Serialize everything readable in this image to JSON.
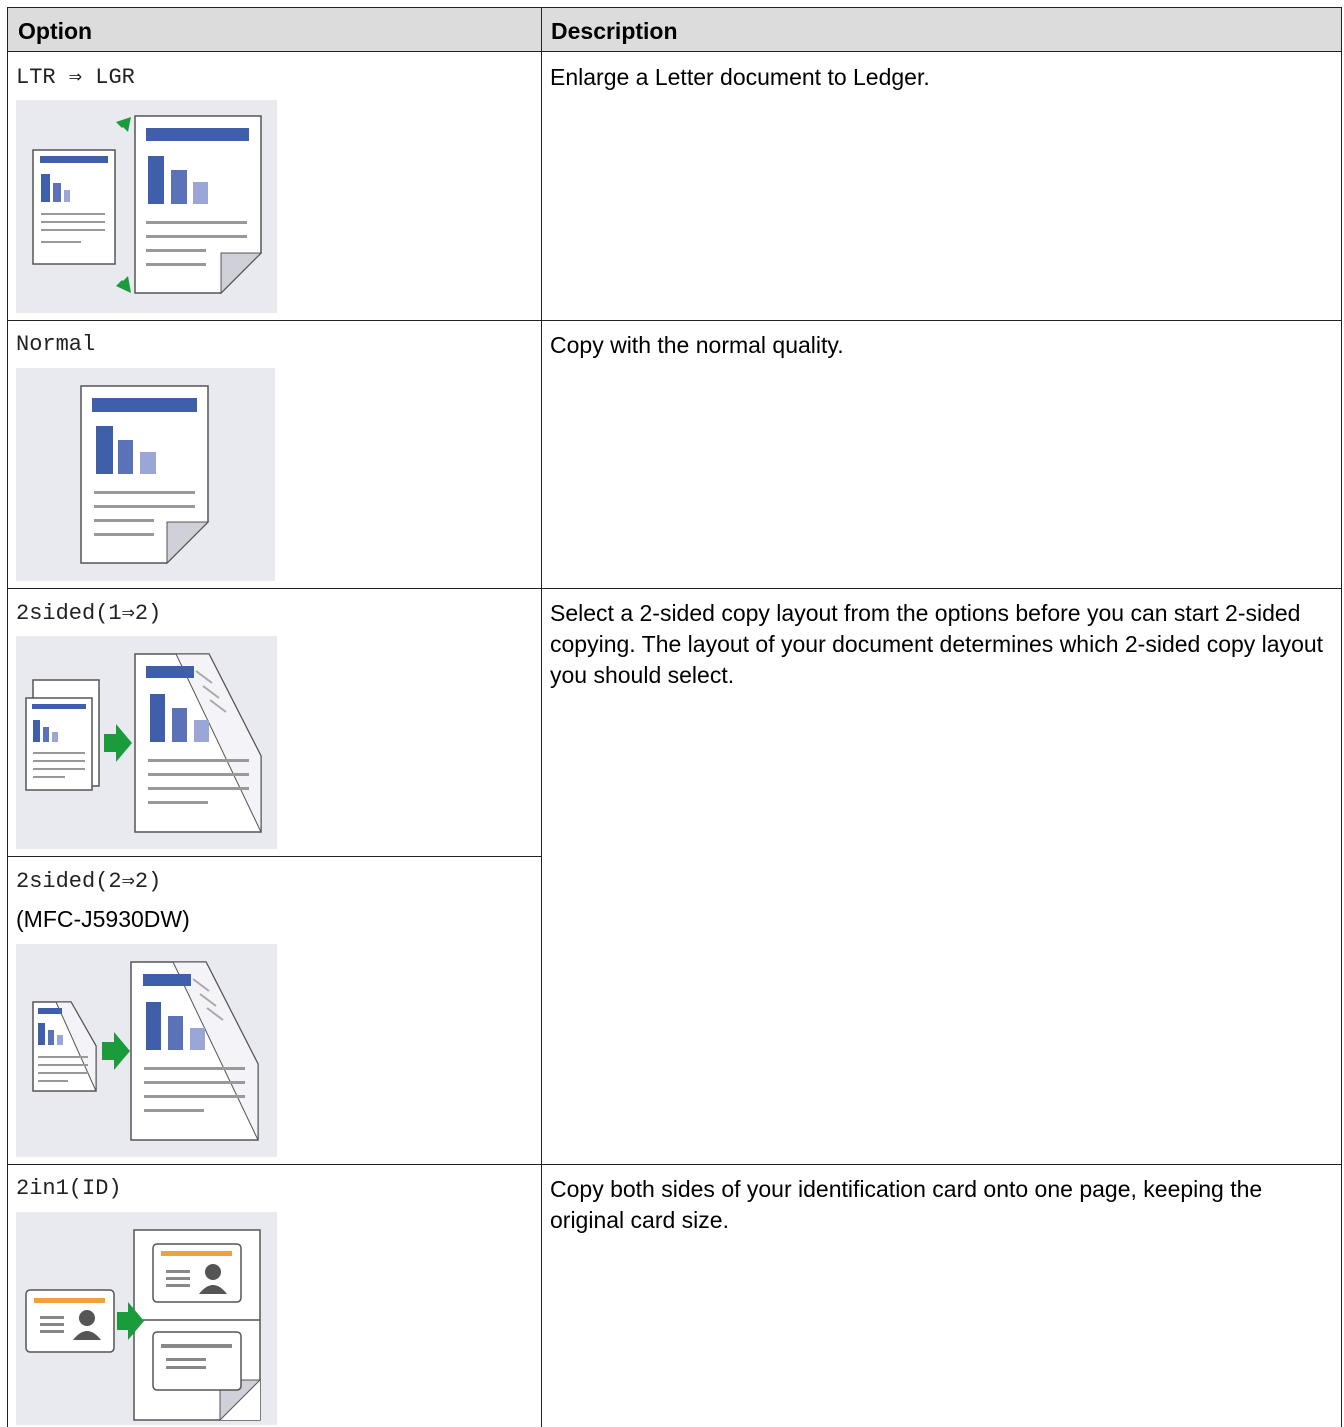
{
  "table": {
    "headers": {
      "option": "Option",
      "description": "Description"
    },
    "rows": [
      {
        "option": "LTR ⇒ LGR",
        "description": "Enlarge a Letter document to Ledger.",
        "illustration": "enlarge-ltr-to-lgr-illustration"
      },
      {
        "option": "Normal",
        "description": "Copy with the normal quality.",
        "illustration": "normal-copy-illustration"
      },
      {
        "option": "2sided(1⇒2)",
        "description": "Select a 2-sided copy layout from the options before you can start 2-sided copying. The layout of your document determines which 2-sided copy layout you should select.",
        "illustration": "two-sided-1-to-2-illustration"
      },
      {
        "option": "2sided(2⇒2)",
        "note": "(MFC-J5930DW)",
        "illustration": "two-sided-2-to-2-illustration"
      },
      {
        "option": "2in1(ID)",
        "description": "Copy both sides of your identification card onto one page, keeping the original card size.",
        "illustration": "two-in-one-id-illustration"
      }
    ]
  },
  "colors": {
    "header_bg": "#dcdcdc",
    "illustration_bg": "#e9eaf0",
    "bar_dark": "#3f5faa",
    "bar_mid": "#5b72b8",
    "bar_light": "#9aa6d6",
    "arrow_green": "#1a9b3c",
    "id_orange": "#f0a040"
  }
}
